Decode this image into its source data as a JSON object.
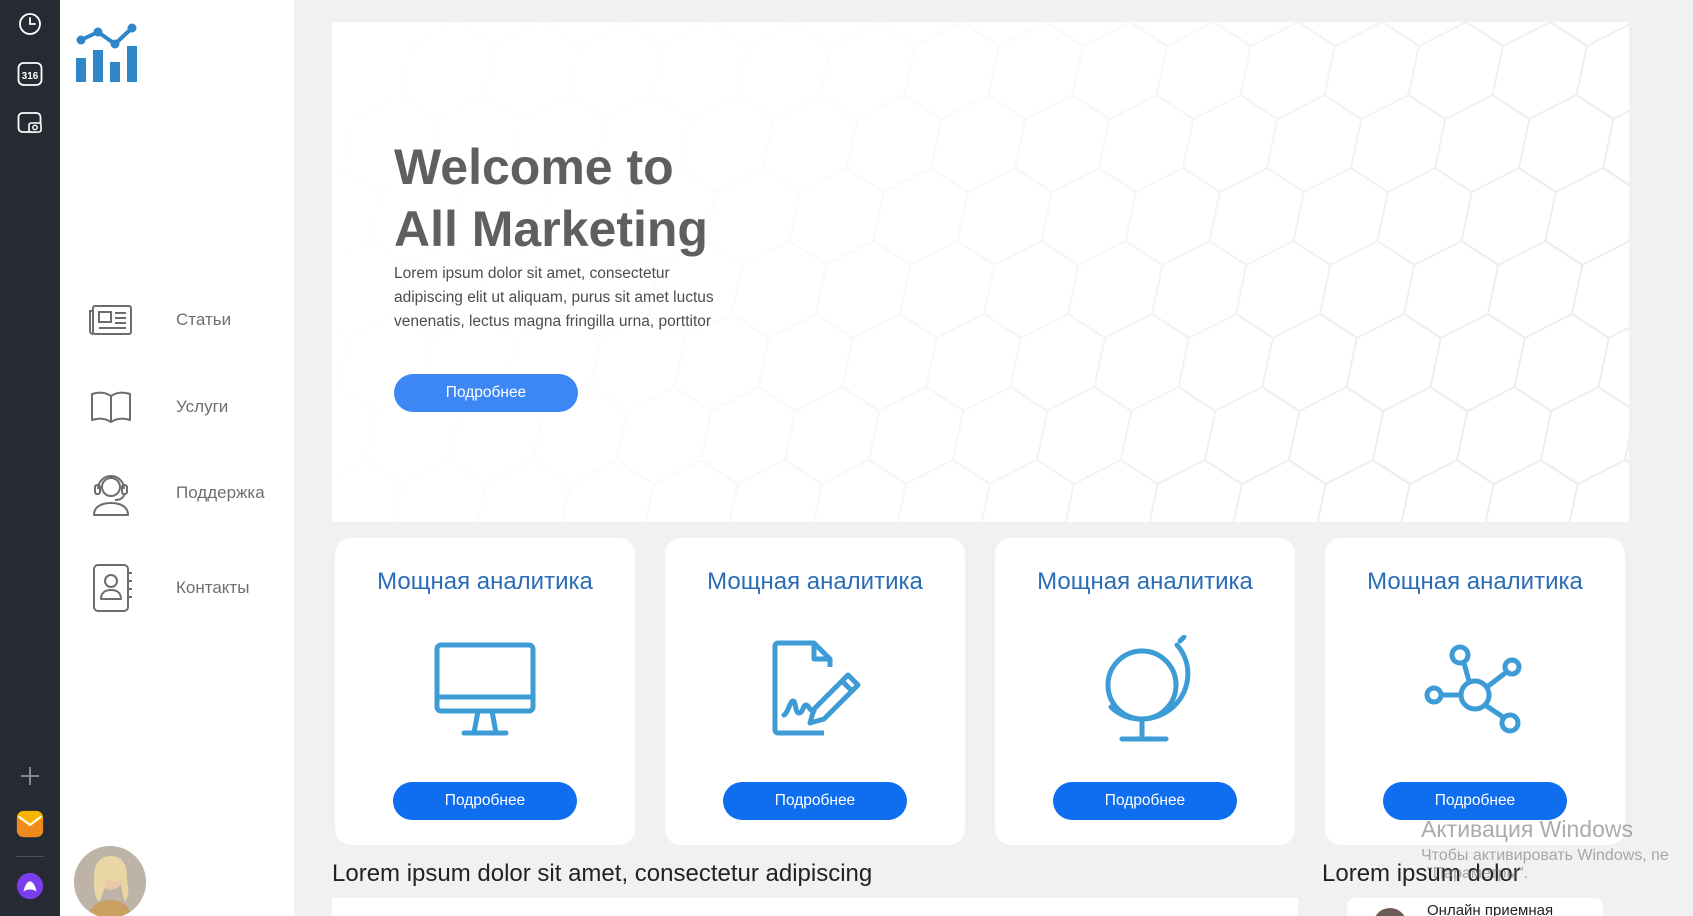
{
  "rail": {
    "items": [
      {
        "name": "clock-icon"
      },
      {
        "name": "calendar-icon",
        "badge": "316"
      },
      {
        "name": "screenshot-icon"
      }
    ],
    "bottom": [
      {
        "name": "add-icon"
      },
      {
        "name": "mail-icon"
      },
      {
        "name": "alice-assistant-icon"
      }
    ]
  },
  "sidebar": {
    "logo": "chart-logo-icon",
    "items": [
      {
        "icon": "newspaper-icon",
        "label": "Статьи"
      },
      {
        "icon": "book-icon",
        "label": "Услуги"
      },
      {
        "icon": "support-headset-icon",
        "label": "Поддержка"
      },
      {
        "icon": "contacts-book-icon",
        "label": "Контакты"
      }
    ]
  },
  "hero": {
    "title_line1": "Welcome to",
    "title_line2": "All Marketing",
    "text": "Lorem ipsum dolor sit amet, consectetur adipiscing elit ut aliquam, purus sit amet luctus venenatis, lectus magna fringilla urna, porttitor",
    "button": "Подробнее"
  },
  "cards": [
    {
      "title": "Мощная аналитика",
      "icon": "monitor-icon",
      "button": "Подробнее"
    },
    {
      "title": "Мощная аналитика",
      "icon": "document-sign-icon",
      "button": "Подробнее"
    },
    {
      "title": "Мощная аналитика",
      "icon": "globe-icon",
      "button": "Подробнее"
    },
    {
      "title": "Мощная аналитика",
      "icon": "network-icon",
      "button": "Подробнее"
    }
  ],
  "bottom": {
    "left_heading": "Lorem ipsum dolor sit amet, consectetur adipiscing",
    "right_heading": "Lorem ipsum dolor",
    "right_card_text": "Онлайн приемная"
  },
  "watermark": {
    "title": "Активация Windows",
    "line1": "Чтобы активировать Windows, пе",
    "line2": "\"Параметры\"."
  },
  "colors": {
    "rail": "#262b33",
    "accent_blue": "#3d9bd6",
    "button_blue": "#0f6ef0",
    "card_title": "#2a6cb5",
    "hero_title": "#5f5f5f"
  }
}
